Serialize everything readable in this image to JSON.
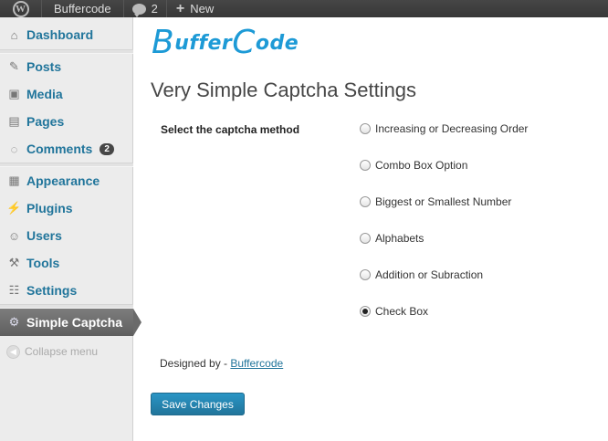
{
  "adminbar": {
    "site_name": "Buffercode",
    "comments_count": "2",
    "new_label": "New",
    "wp_logo": "W"
  },
  "sidebar": {
    "items": [
      {
        "label": "Dashboard",
        "icon": "home-icon"
      },
      {
        "label": "Posts",
        "icon": "pin-icon"
      },
      {
        "label": "Media",
        "icon": "media-icon"
      },
      {
        "label": "Pages",
        "icon": "pages-icon"
      },
      {
        "label": "Comments",
        "icon": "comment-icon",
        "badge": "2"
      },
      {
        "label": "Appearance",
        "icon": "appearance-icon"
      },
      {
        "label": "Plugins",
        "icon": "plugin-icon"
      },
      {
        "label": "Users",
        "icon": "users-icon"
      },
      {
        "label": "Tools",
        "icon": "tools-icon"
      },
      {
        "label": "Settings",
        "icon": "settings-icon"
      },
      {
        "label": "Simple Captcha",
        "icon": "gear-icon",
        "current": true
      }
    ],
    "collapse_label": "Collapse menu"
  },
  "main": {
    "logo_b": "B",
    "logo_mid": "uffer",
    "logo_c": "C",
    "logo_end": "ode",
    "title": "Very Simple Captcha Settings",
    "method_label": "Select the captcha method",
    "options": [
      {
        "label": "Increasing or Decreasing Order",
        "checked": false
      },
      {
        "label": "Combo Box Option",
        "checked": false
      },
      {
        "label": "Biggest or Smallest Number",
        "checked": false
      },
      {
        "label": "Alphabets",
        "checked": false
      },
      {
        "label": "Addition or Subraction",
        "checked": false
      },
      {
        "label": "Check Box",
        "checked": true
      }
    ],
    "designed_by_prefix": "Designed by - ",
    "designed_by_link": "Buffercode",
    "save_label": "Save Changes"
  },
  "colors": {
    "link": "#21759b",
    "adminbar": "#464646",
    "logo": "#1d9ad6"
  }
}
